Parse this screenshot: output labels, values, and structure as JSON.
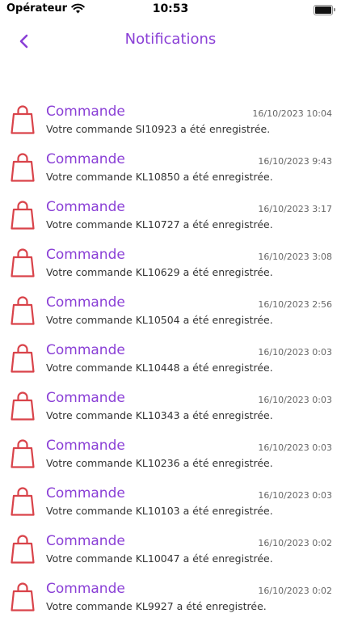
{
  "status_bar": {
    "carrier": "Opérateur",
    "time": "10:53"
  },
  "header": {
    "title": "Notifications",
    "back_icon": "chevron-left-icon"
  },
  "colors": {
    "accent": "#8a3fd6",
    "icon_red": "#d9434a"
  },
  "notifications": [
    {
      "title": "Commande",
      "timestamp": "16/10/2023 10:04",
      "message": "Votre commande SI10923 a été enregistrée.",
      "icon": "shopping-bag-icon"
    },
    {
      "title": "Commande",
      "timestamp": "16/10/2023 9:43",
      "message": "Votre commande KL10850 a été enregistrée.",
      "icon": "shopping-bag-icon"
    },
    {
      "title": "Commande",
      "timestamp": "16/10/2023 3:17",
      "message": "Votre commande KL10727 a été enregistrée.",
      "icon": "shopping-bag-icon"
    },
    {
      "title": "Commande",
      "timestamp": "16/10/2023 3:08",
      "message": "Votre commande KL10629 a été enregistrée.",
      "icon": "shopping-bag-icon"
    },
    {
      "title": "Commande",
      "timestamp": "16/10/2023 2:56",
      "message": "Votre commande KL10504 a été enregistrée.",
      "icon": "shopping-bag-icon"
    },
    {
      "title": "Commande",
      "timestamp": "16/10/2023 0:03",
      "message": "Votre commande KL10448 a été enregistrée.",
      "icon": "shopping-bag-icon"
    },
    {
      "title": "Commande",
      "timestamp": "16/10/2023 0:03",
      "message": "Votre commande KL10343 a été enregistrée.",
      "icon": "shopping-bag-icon"
    },
    {
      "title": "Commande",
      "timestamp": "16/10/2023 0:03",
      "message": "Votre commande KL10236 a été enregistrée.",
      "icon": "shopping-bag-icon"
    },
    {
      "title": "Commande",
      "timestamp": "16/10/2023 0:03",
      "message": "Votre commande KL10103 a été enregistrée.",
      "icon": "shopping-bag-icon"
    },
    {
      "title": "Commande",
      "timestamp": "16/10/2023 0:02",
      "message": "Votre commande KL10047 a été enregistrée.",
      "icon": "shopping-bag-icon"
    },
    {
      "title": "Commande",
      "timestamp": "16/10/2023 0:02",
      "message": "Votre commande KL9927 a été enregistrée.",
      "icon": "shopping-bag-icon"
    }
  ]
}
